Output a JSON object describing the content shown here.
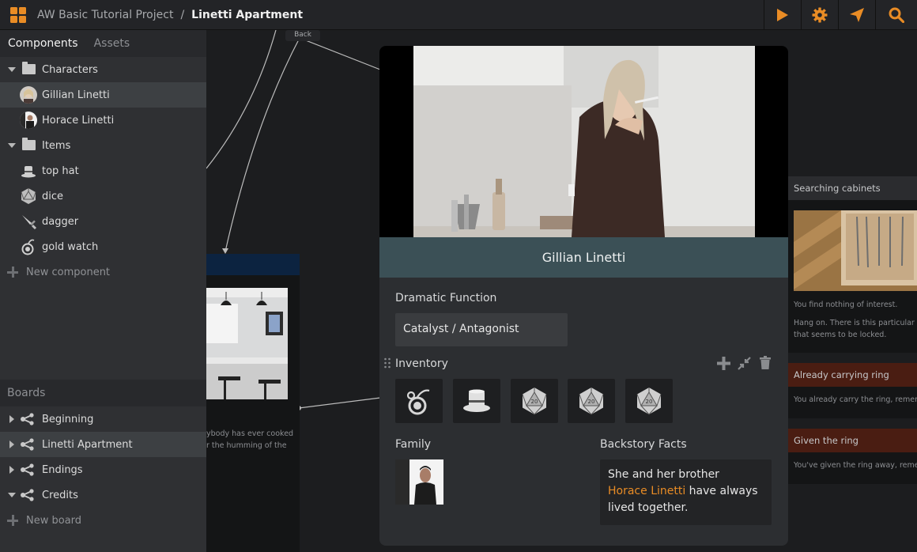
{
  "topbar": {
    "project": "AW Basic Tutorial Project",
    "separator": "/",
    "current": "Linetti Apartment",
    "accent": "#e98c25",
    "actions": [
      "play-icon",
      "gear-icon",
      "send-icon",
      "search-icon"
    ]
  },
  "sidebar": {
    "tabs": [
      "Components",
      "Assets"
    ],
    "tree": {
      "characters_folder": "Characters",
      "characters": [
        "Gillian Linetti",
        "Horace Linetti"
      ],
      "items_folder": "Items",
      "items": [
        "top hat",
        "dice",
        "dagger",
        "gold watch"
      ],
      "new_component": "New component"
    },
    "boards_header": "Boards",
    "boards": [
      "Beginning",
      "Linetti Apartment",
      "Endings",
      "Credits"
    ],
    "new_board": "New board"
  },
  "canvas": {
    "back_label": "Back",
    "left_node_text": [
      "ybody has ever cooked",
      "r the humming of the"
    ],
    "right_nodes": [
      {
        "title": "Searching cabinets",
        "lines": [
          "You find nothing of interest.",
          "",
          "Hang on. There is this particular dr",
          "that seems to be locked."
        ]
      },
      {
        "title": "Already carrying ring",
        "lines": [
          "You already carry the ring, remem"
        ]
      },
      {
        "title": "Given the ring",
        "lines": [
          "You've given the ring away, remem"
        ]
      }
    ]
  },
  "card": {
    "name": "Gillian Linetti",
    "dramatic_function_label": "Dramatic Function",
    "dramatic_function_value": "Catalyst / Antagonist",
    "inventory_label": "Inventory",
    "inventory_items": [
      "gold-watch-icon",
      "top-hat-icon",
      "dice-icon",
      "dice-icon",
      "dice-icon"
    ],
    "family_label": "Family",
    "backstory_label": "Backstory Facts",
    "backstory_before": "She and her brother",
    "backstory_link": "Horace Linetti",
    "backstory_after": " have always lived together."
  }
}
